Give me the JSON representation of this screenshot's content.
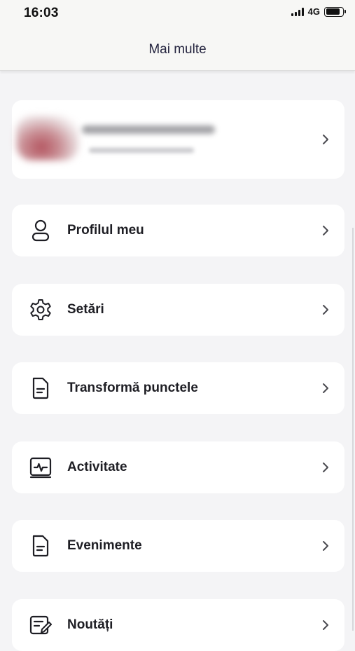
{
  "status_bar": {
    "time": "16:03",
    "network": "4G",
    "battery_level": 0.85
  },
  "header": {
    "title": "Mai multe"
  },
  "account_card": {
    "name": "",
    "subtitle": ""
  },
  "menu": [
    {
      "label": "Profilul meu",
      "icon": "user-icon"
    },
    {
      "label": "Setări",
      "icon": "gear-icon"
    },
    {
      "label": "Transformă punctele",
      "icon": "document-icon"
    },
    {
      "label": "Activitate",
      "icon": "activity-monitor-icon"
    },
    {
      "label": "Evenimente",
      "icon": "document-icon"
    },
    {
      "label": "Noutăți",
      "icon": "news-edit-icon"
    }
  ],
  "colors": {
    "background": "#f4f4f6",
    "card": "#ffffff",
    "text": "#1e1e24",
    "title": "#262640",
    "chevron": "#4a4a50"
  }
}
